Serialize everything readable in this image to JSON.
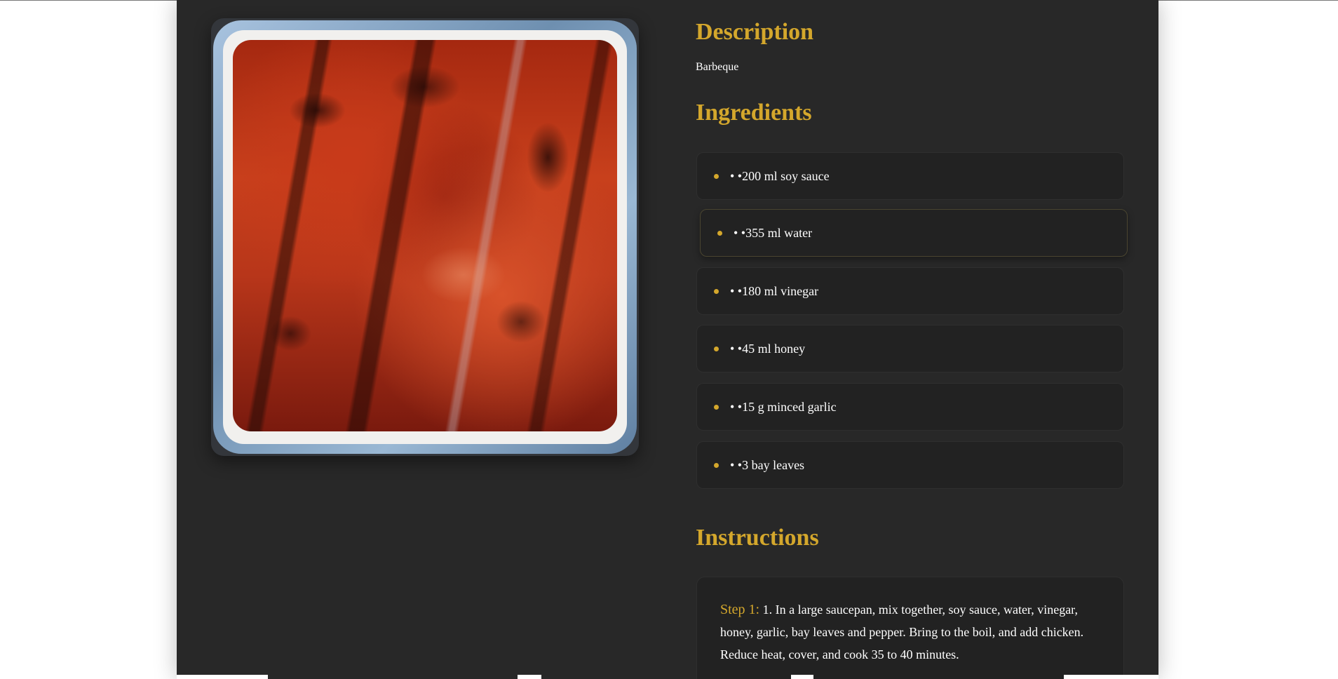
{
  "description": {
    "heading": "Description",
    "text": "Barbeque"
  },
  "ingredients": {
    "heading": "Ingredients",
    "items": [
      {
        "label": "• •200 ml soy sauce"
      },
      {
        "label": "• •355 ml water"
      },
      {
        "label": "• •180 ml vinegar"
      },
      {
        "label": "• •45 ml honey"
      },
      {
        "label": "• •15 g minced garlic"
      },
      {
        "label": "• •3 bay leaves"
      }
    ]
  },
  "instructions": {
    "heading": "Instructions",
    "steps": [
      {
        "label": "Step 1:",
        "text": "1. In a large saucepan, mix together, soy sauce, water, vinegar, honey, garlic, bay leaves and pepper. Bring to the boil, and add chicken. Reduce heat, cover, and cook 35 to 40 minutes."
      }
    ]
  },
  "colors": {
    "accent": "#d4a72c",
    "page_bg": "#282828",
    "card_bg": "#222222",
    "text": "#ffffff"
  }
}
